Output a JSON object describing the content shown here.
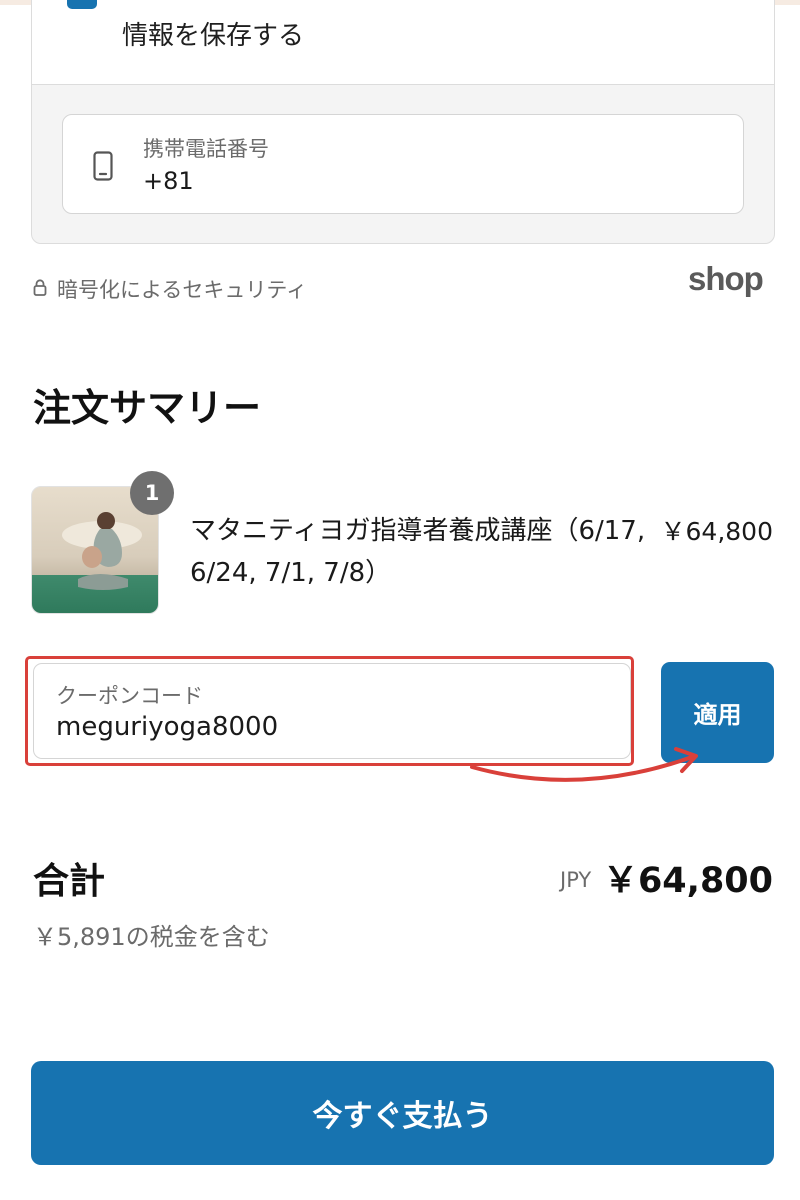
{
  "contact": {
    "save_info_label": "情報を保存する",
    "phone_label": "携帯電話番号",
    "phone_value": "+81"
  },
  "security": {
    "text": "暗号化によるセキュリティ",
    "shop_logo": "shop"
  },
  "summary": {
    "title": "注文サマリー",
    "item": {
      "quantity": "1",
      "name": "マタニティヨガ指導者養成講座（6/17, 6/24, 7/1, 7/8）",
      "price": "￥64,800"
    }
  },
  "coupon": {
    "label": "クーポンコード",
    "value": "meguriyoga8000",
    "apply_label": "適用"
  },
  "total": {
    "label": "合計",
    "currency": "JPY",
    "amount": "￥64,800",
    "tax_note": "￥5,891の税金を含む"
  },
  "pay_button_label": "今すぐ支払う",
  "colors": {
    "primary": "#1773b0",
    "highlight": "#d9403a"
  },
  "icons": [
    "phone-icon",
    "lock-icon",
    "arrow-icon"
  ]
}
